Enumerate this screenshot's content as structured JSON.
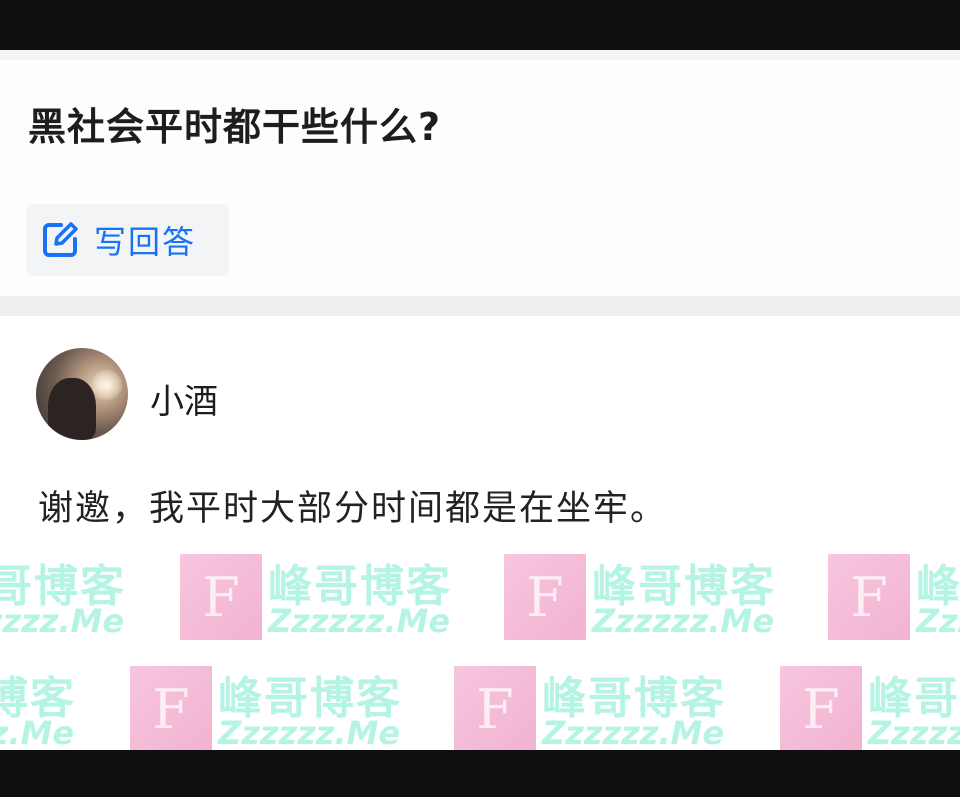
{
  "question": {
    "title": "黑社会平时都干些什么?",
    "write_answer_label": "写回答"
  },
  "answer": {
    "author_name": "小酒",
    "text": "谢邀，我平时大部分时间都是在坐牢。"
  },
  "watermark": {
    "logo_letter": "F",
    "title": "峰哥博客",
    "subtitle": "Zzzzzz.Me"
  },
  "colors": {
    "accent": "#1772f6",
    "watermark_text": "#78ebcd",
    "watermark_logo": "#f6bcd9"
  },
  "icons": {
    "write_answer": "edit-pencil-icon"
  }
}
